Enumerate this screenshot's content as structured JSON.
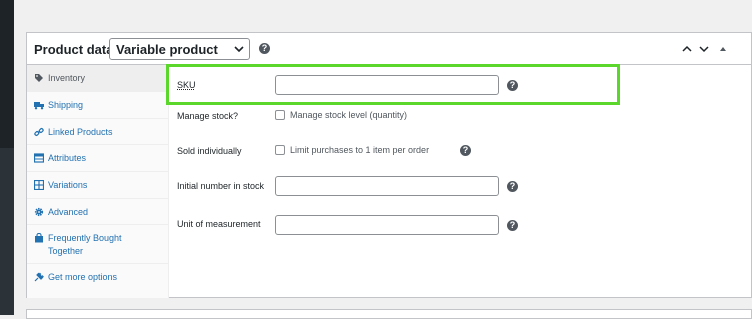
{
  "header": {
    "title": "Product data —",
    "product_type": "Variable product",
    "help_glyph": "?"
  },
  "sidebar": {
    "items": [
      {
        "label": "Inventory",
        "icon": "tag-icon",
        "active": true
      },
      {
        "label": "Shipping",
        "icon": "truck-icon",
        "active": false
      },
      {
        "label": "Linked Products",
        "icon": "link-icon",
        "active": false
      },
      {
        "label": "Attributes",
        "icon": "table-icon",
        "active": false
      },
      {
        "label": "Variations",
        "icon": "grid-icon",
        "active": false
      },
      {
        "label": "Advanced",
        "icon": "gear-icon",
        "active": false
      },
      {
        "label": "Frequently Bought Together",
        "icon": "bag-icon",
        "active": false
      },
      {
        "label": "Get more options",
        "icon": "plugin-icon",
        "active": false
      }
    ]
  },
  "fields": {
    "sku": {
      "label": "SKU",
      "value": ""
    },
    "manage_stock": {
      "label": "Manage stock?",
      "checkbox_text": "Manage stock level (quantity)",
      "checked": false
    },
    "sold_individually": {
      "label": "Sold individually",
      "checkbox_text": "Limit purchases to 1 item per order",
      "checked": false
    },
    "initial_stock": {
      "label": "Initial number in stock",
      "value": ""
    },
    "unit": {
      "label": "Unit of measurement",
      "value": ""
    }
  },
  "colors": {
    "link": "#2271b1",
    "highlight": "#5bd62b",
    "admin_bar": "#1d2327"
  }
}
